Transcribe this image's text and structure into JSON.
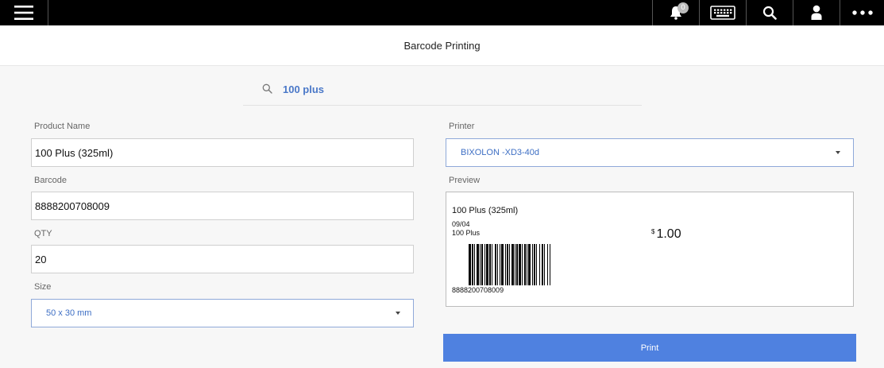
{
  "topbar": {
    "notification_count": "0",
    "icons": [
      "menu-icon",
      "bell-icon",
      "keyboard-icon",
      "search-icon",
      "user-icon",
      "more-icon"
    ]
  },
  "header": {
    "title": "Barcode Printing"
  },
  "search": {
    "value": "100 plus"
  },
  "form": {
    "product_name_label": "Product Name",
    "product_name_value": "100 Plus (325ml)",
    "barcode_label": "Barcode",
    "barcode_value": "8888200708009",
    "qty_label": "QTY",
    "qty_value": "20",
    "size_label": "Size",
    "size_value": "50 x 30 mm"
  },
  "printer": {
    "label": "Printer",
    "value": "BIXOLON -XD3-40d"
  },
  "preview": {
    "label": "Preview",
    "product_name": "100 Plus (325ml)",
    "date": "09/04",
    "short_name": "100 Plus",
    "currency": "$",
    "price": "1.00",
    "barcode_text": "8888200708009"
  },
  "actions": {
    "print_label": "Print"
  },
  "colors": {
    "topbar": "#000000",
    "accent": "#4f81e0",
    "link_text": "#3e6fc4"
  }
}
